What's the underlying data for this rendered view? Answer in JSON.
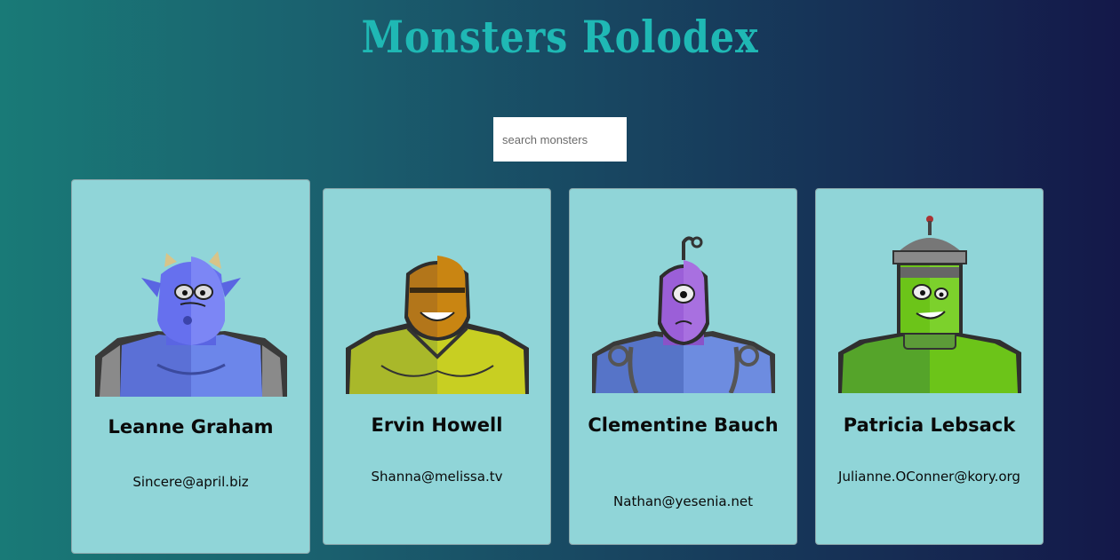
{
  "app": {
    "title": "Monsters Rolodex"
  },
  "search": {
    "placeholder": "search monsters",
    "value": ""
  },
  "monsters": [
    {
      "name": "Leanne Graham",
      "email": "Sincere@april.biz"
    },
    {
      "name": "Ervin Howell",
      "email": "Shanna@melissa.tv"
    },
    {
      "name": "Clementine Bauch",
      "email": "Nathan@yesenia.net"
    },
    {
      "name": "Patricia Lebsack",
      "email": "Julianne.OConner@kory.org"
    }
  ],
  "colors": {
    "title": "#1fb8b4",
    "card_background": "#90d5d8",
    "background_left": "#197a77",
    "background_right": "#141849"
  }
}
